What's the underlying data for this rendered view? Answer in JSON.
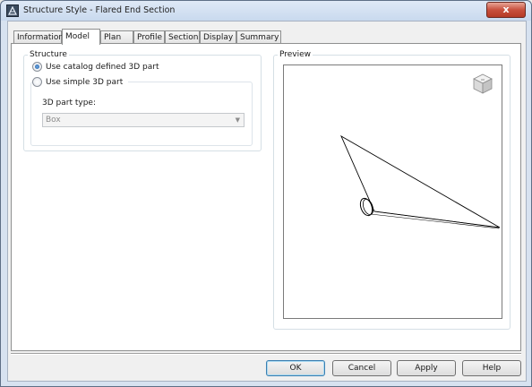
{
  "window": {
    "title": "Structure Style - Flared End Section",
    "close_glyph": "x"
  },
  "tabs": [
    {
      "label": "Information",
      "active": false
    },
    {
      "label": "Model",
      "active": true
    },
    {
      "label": "Plan",
      "active": false
    },
    {
      "label": "Profile",
      "active": false
    },
    {
      "label": "Section",
      "active": false
    },
    {
      "label": "Display",
      "active": false
    },
    {
      "label": "Summary",
      "active": false
    }
  ],
  "structure": {
    "group_label": "Structure",
    "option_catalog": {
      "label": "Use catalog defined 3D part",
      "checked": true
    },
    "option_simple": {
      "label": "Use simple 3D part",
      "checked": false
    },
    "part_type_label": "3D part type:",
    "part_type_value": "Box"
  },
  "preview": {
    "group_label": "Preview",
    "viewcube_icon": "viewcube-icon"
  },
  "buttons": {
    "ok": "OK",
    "cancel": "Cancel",
    "apply": "Apply",
    "help": "Help"
  },
  "colors": {
    "title_bar": "#c9d9ee",
    "close_button": "#c8503d",
    "radio_checked": "#1f5fa8",
    "default_button_border": "#3c7fb1"
  }
}
